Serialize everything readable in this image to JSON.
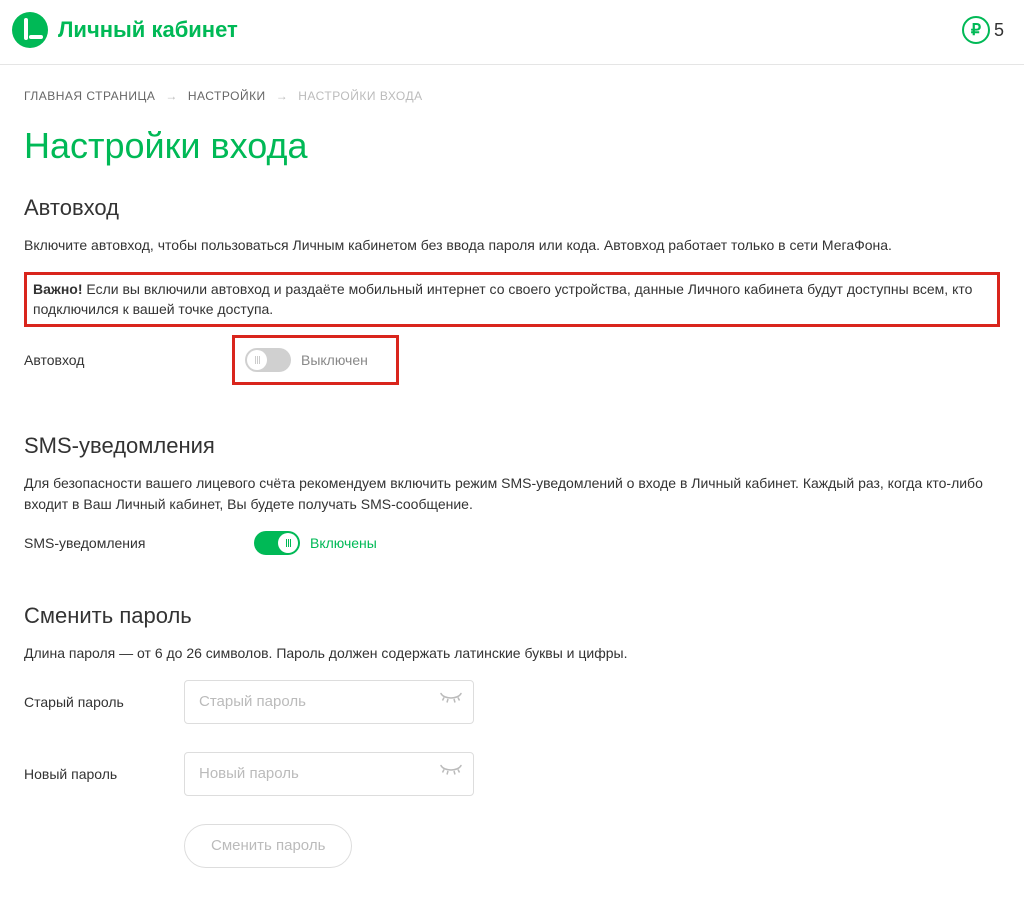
{
  "header": {
    "brand_title": "Личный кабинет",
    "balance_trailing": "5"
  },
  "breadcrumbs": {
    "home": "ГЛАВНАЯ СТРАНИЦА",
    "settings": "НАСТРОЙКИ",
    "current": "НАСТРОЙКИ ВХОДА"
  },
  "page_title": "Настройки входа",
  "autologin": {
    "title": "Автовход",
    "desc": "Включите автовход, чтобы пользоваться Личным кабинетом без ввода пароля или кода. Автовход работает только в сети МегаФона.",
    "warn_label": "Важно!",
    "warn_text": " Если вы включили автовход и раздаёте мобильный интернет со своего устройства, данные Личного кабинета будут доступны всем, кто подключился к вашей точке доступа.",
    "field_label": "Автовход",
    "status": "Выключен"
  },
  "sms": {
    "title": "SMS-уведомления",
    "desc": "Для безопасности вашего лицевого счёта рекомендуем включить режим SMS-уведомлений о входе в Личный кабинет. Каждый раз, когда кто-либо входит в Ваш Личный кабинет, Вы будете получать SMS-сообщение.",
    "field_label": "SMS-уведомления",
    "status": "Включены"
  },
  "password": {
    "title": "Сменить пароль",
    "desc": "Длина пароля — от 6 до 26 символов. Пароль должен содержать латинские буквы и цифры.",
    "old_label": "Старый пароль",
    "old_placeholder": "Старый пароль",
    "new_label": "Новый пароль",
    "new_placeholder": "Новый пароль",
    "submit": "Сменить пароль"
  }
}
